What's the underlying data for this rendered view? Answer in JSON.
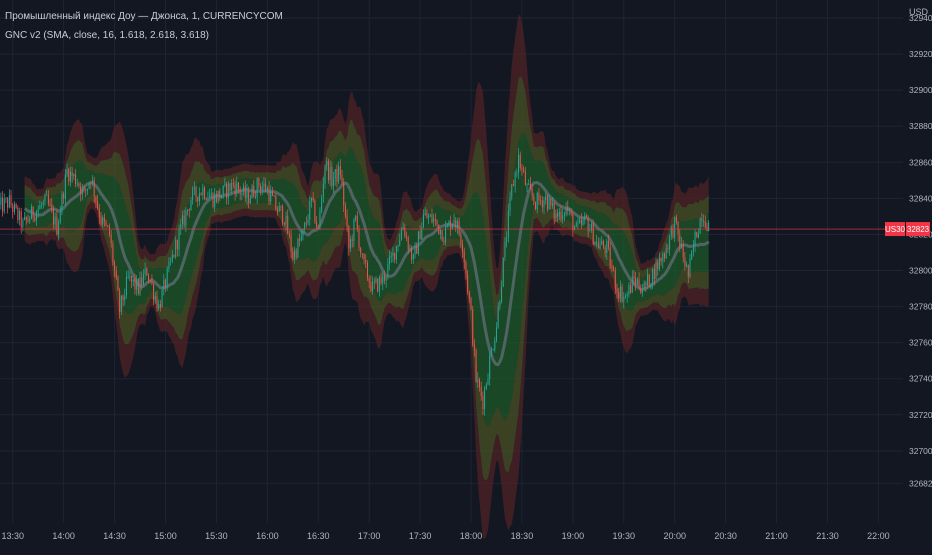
{
  "header": {
    "symbol_title": "Промышленный индекс Доу — Джонса, 1, CURRENCYCOM",
    "indicator_title": "GNC v2 (SMA, close, 16, 1.618, 2.618, 3.618)",
    "currency": "USD"
  },
  "colors": {
    "background": "#131722",
    "grid": "#1f2433",
    "candle_up": "#26a69a",
    "candle_down": "#ef5350",
    "band_inner": "#1e5a2a",
    "band_mid": "#4a5226",
    "band_outer": "#4f2326",
    "center_line": "#5d6b73",
    "last_price": "#f23645"
  },
  "price_tag": {
    "symbol": "US30",
    "price": "32823"
  },
  "chart_data": {
    "type": "candlestick",
    "title": "Промышленный индекс Доу — Джонса, 1, CURRENCYCOM",
    "ylabel": "USD",
    "ylim": [
      32660,
      32950
    ],
    "yticks": [
      32940,
      32920,
      32900,
      32880,
      32860,
      32840,
      32820,
      32800,
      32780,
      32760,
      32740,
      32720,
      32700,
      32682
    ],
    "ytick_labels": [
      "32940",
      "32920",
      "32900",
      "32880",
      "32860",
      "32840",
      "32820",
      "32800",
      "32780",
      "32760",
      "32740",
      "32720",
      "32700",
      "32682"
    ],
    "xticks": [
      "13:30",
      "14:00",
      "14:30",
      "15:00",
      "15:30",
      "16:00",
      "16:30",
      "17:00",
      "17:30",
      "18:00",
      "18:30",
      "19:00",
      "19:30",
      "20:00",
      "20:30",
      "21:00",
      "21:30",
      "22:00"
    ],
    "xtick_minutes": [
      810,
      840,
      870,
      900,
      930,
      960,
      990,
      1020,
      1050,
      1080,
      1110,
      1140,
      1170,
      1200,
      1230,
      1260,
      1290,
      1320
    ],
    "x_range_minutes": [
      802.5,
      1334.5
    ],
    "grid": true,
    "last_price": 32823,
    "indicator": {
      "name": "GNC v2",
      "method": "SMA",
      "source": "close",
      "length": 16,
      "multipliers": [
        1.618,
        2.618,
        3.618
      ]
    },
    "anchors": [
      {
        "t": 802,
        "p": 32835
      },
      {
        "t": 808,
        "p": 32838
      },
      {
        "t": 816,
        "p": 32825
      },
      {
        "t": 822,
        "p": 32832
      },
      {
        "t": 830,
        "p": 32838
      },
      {
        "t": 836,
        "p": 32824
      },
      {
        "t": 842,
        "p": 32855
      },
      {
        "t": 848,
        "p": 32850
      },
      {
        "t": 852,
        "p": 32842
      },
      {
        "t": 856,
        "p": 32852
      },
      {
        "t": 862,
        "p": 32828
      },
      {
        "t": 867,
        "p": 32820
      },
      {
        "t": 873,
        "p": 32778
      },
      {
        "t": 878,
        "p": 32795
      },
      {
        "t": 884,
        "p": 32790
      },
      {
        "t": 889,
        "p": 32800
      },
      {
        "t": 896,
        "p": 32780
      },
      {
        "t": 902,
        "p": 32800
      },
      {
        "t": 908,
        "p": 32820
      },
      {
        "t": 915,
        "p": 32840
      },
      {
        "t": 922,
        "p": 32845
      },
      {
        "t": 928,
        "p": 32840
      },
      {
        "t": 934,
        "p": 32843
      },
      {
        "t": 940,
        "p": 32848
      },
      {
        "t": 948,
        "p": 32840
      },
      {
        "t": 955,
        "p": 32848
      },
      {
        "t": 960,
        "p": 32845
      },
      {
        "t": 965,
        "p": 32835
      },
      {
        "t": 970,
        "p": 32830
      },
      {
        "t": 975,
        "p": 32808
      },
      {
        "t": 981,
        "p": 32820
      },
      {
        "t": 986,
        "p": 32838
      },
      {
        "t": 990,
        "p": 32822
      },
      {
        "t": 994,
        "p": 32860
      },
      {
        "t": 998,
        "p": 32850
      },
      {
        "t": 1003,
        "p": 32855
      },
      {
        "t": 1008,
        "p": 32812
      },
      {
        "t": 1012,
        "p": 32828
      },
      {
        "t": 1016,
        "p": 32805
      },
      {
        "t": 1022,
        "p": 32790
      },
      {
        "t": 1028,
        "p": 32795
      },
      {
        "t": 1034,
        "p": 32808
      },
      {
        "t": 1040,
        "p": 32825
      },
      {
        "t": 1046,
        "p": 32805
      },
      {
        "t": 1052,
        "p": 32830
      },
      {
        "t": 1058,
        "p": 32828
      },
      {
        "t": 1064,
        "p": 32820
      },
      {
        "t": 1070,
        "p": 32830
      },
      {
        "t": 1075,
        "p": 32815
      },
      {
        "t": 1080,
        "p": 32775
      },
      {
        "t": 1083,
        "p": 32740
      },
      {
        "t": 1087,
        "p": 32728
      },
      {
        "t": 1091,
        "p": 32750
      },
      {
        "t": 1095,
        "p": 32770
      },
      {
        "t": 1100,
        "p": 32812
      },
      {
        "t": 1104,
        "p": 32845
      },
      {
        "t": 1108,
        "p": 32862
      },
      {
        "t": 1113,
        "p": 32845
      },
      {
        "t": 1118,
        "p": 32838
      },
      {
        "t": 1124,
        "p": 32840
      },
      {
        "t": 1130,
        "p": 32830
      },
      {
        "t": 1136,
        "p": 32835
      },
      {
        "t": 1142,
        "p": 32822
      },
      {
        "t": 1148,
        "p": 32828
      },
      {
        "t": 1154,
        "p": 32815
      },
      {
        "t": 1160,
        "p": 32812
      },
      {
        "t": 1166,
        "p": 32790
      },
      {
        "t": 1171,
        "p": 32785
      },
      {
        "t": 1176,
        "p": 32795
      },
      {
        "t": 1182,
        "p": 32790
      },
      {
        "t": 1188,
        "p": 32800
      },
      {
        "t": 1194,
        "p": 32810
      },
      {
        "t": 1200,
        "p": 32826
      },
      {
        "t": 1205,
        "p": 32808
      },
      {
        "t": 1208,
        "p": 32797
      },
      {
        "t": 1212,
        "p": 32818
      },
      {
        "t": 1216,
        "p": 32832
      },
      {
        "t": 1220,
        "p": 32825
      }
    ]
  }
}
